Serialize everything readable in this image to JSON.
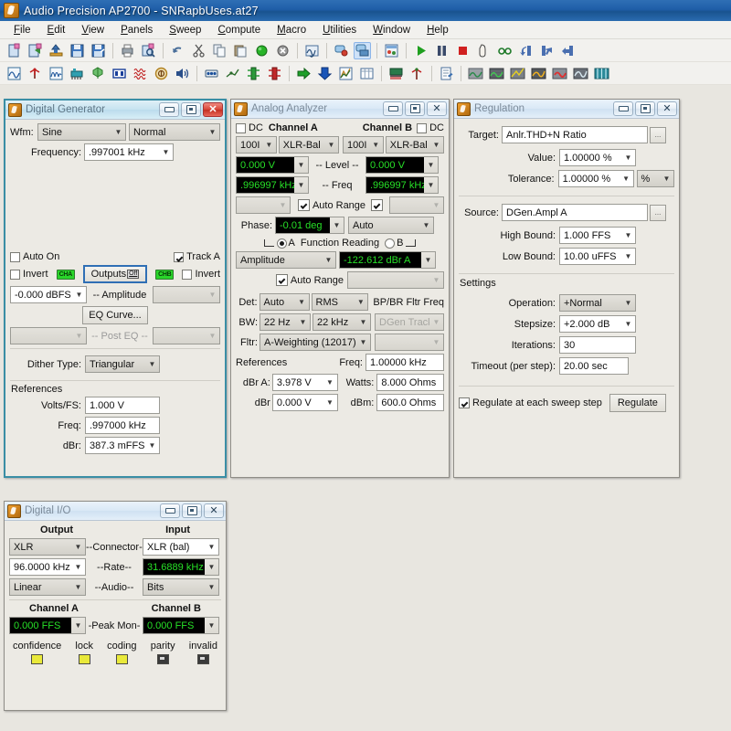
{
  "window": {
    "title": "Audio Precision AP2700 - SNRapbUses.at27",
    "app_icon": "ap-logo-icon"
  },
  "menubar": {
    "items": [
      {
        "label": "File",
        "accel": "F"
      },
      {
        "label": "Edit",
        "accel": "E"
      },
      {
        "label": "View",
        "accel": "V"
      },
      {
        "label": "Panels",
        "accel": "P"
      },
      {
        "label": "Sweep",
        "accel": "S"
      },
      {
        "label": "Compute",
        "accel": "C"
      },
      {
        "label": "Macro",
        "accel": "M"
      },
      {
        "label": "Utilities",
        "accel": "U"
      },
      {
        "label": "Window",
        "accel": "W"
      },
      {
        "label": "Help",
        "accel": "H"
      }
    ]
  },
  "toolbar_row1": [
    {
      "name": "new-test-icon"
    },
    {
      "name": "open-test-icon"
    },
    {
      "name": "load-settings-icon"
    },
    {
      "name": "save-icon"
    },
    {
      "name": "save-as-icon"
    },
    {
      "sep": true
    },
    {
      "name": "print-icon"
    },
    {
      "name": "print-preview-icon"
    },
    {
      "sep": true
    },
    {
      "name": "undo-icon"
    },
    {
      "name": "cut-icon"
    },
    {
      "name": "copy-icon"
    },
    {
      "name": "paste-icon"
    },
    {
      "name": "go-green-icon"
    },
    {
      "name": "stop-gray-icon"
    },
    {
      "sep": true
    },
    {
      "name": "waveform-display-icon"
    },
    {
      "sep": true
    },
    {
      "name": "comment-red-icon"
    },
    {
      "name": "comment-blue-icon",
      "selected": true
    },
    {
      "sep": true
    },
    {
      "name": "panel-properties-icon"
    },
    {
      "sep": true
    },
    {
      "name": "run-icon"
    },
    {
      "name": "pause-icon"
    },
    {
      "name": "stop-icon"
    },
    {
      "name": "mouse-pointer-icon"
    },
    {
      "name": "glasses-icon"
    },
    {
      "name": "step-back-icon"
    },
    {
      "name": "step-into-icon"
    },
    {
      "name": "step-out-icon"
    }
  ],
  "toolbar_row2": [
    {
      "name": "analog-analyzer-icon"
    },
    {
      "name": "analog-generator-icon"
    },
    {
      "name": "sweep-panel-icon"
    },
    {
      "name": "digital-io-icon"
    },
    {
      "name": "digital-generator-icon"
    },
    {
      "name": "dsp-audio-icon"
    },
    {
      "name": "bandpass-icon"
    },
    {
      "name": "multitone-icon"
    },
    {
      "name": "speaker-icon"
    },
    {
      "sep": true
    },
    {
      "name": "external-sync-icon"
    },
    {
      "name": "signal-path-icon"
    },
    {
      "name": "switcher-a-icon"
    },
    {
      "name": "switcher-b-icon"
    },
    {
      "sep": true
    },
    {
      "name": "export-icon"
    },
    {
      "name": "import-icon"
    },
    {
      "name": "graph-icon"
    },
    {
      "name": "data-table-icon"
    },
    {
      "sep": true
    },
    {
      "name": "regulation-icon"
    },
    {
      "name": "sweep-start-icon"
    },
    {
      "sep": true
    },
    {
      "name": "report-icon"
    },
    {
      "sep": true
    },
    {
      "name": "bargraph-gray-icon"
    },
    {
      "name": "bargraph-green-icon"
    },
    {
      "name": "bargraph-yellow-icon"
    },
    {
      "name": "bargraph-orange-icon"
    },
    {
      "name": "bargraph-red-icon"
    },
    {
      "name": "bargraph-dark-icon"
    },
    {
      "name": "bargraph-teal-icon"
    }
  ],
  "digital_generator": {
    "title": "Digital Generator",
    "wfm_label": "Wfm:",
    "waveform": "Sine",
    "waveform_mode": "Normal",
    "frequency_label": "Frequency:",
    "frequency": ".997001 kHz",
    "auto_on_label": "Auto On",
    "auto_on_checked": false,
    "invert_a_label": "Invert",
    "invert_a_checked": false,
    "track_a_label": "Track A",
    "track_a_checked": true,
    "invert_b_label": "Invert",
    "invert_b_checked": false,
    "cha_badge": "CHA",
    "chb_badge": "CHB",
    "outputs_label": "Outputs",
    "outputs_state": "Off",
    "amplitude_a": "-0.000   dBFS",
    "amplitude_label": "-- Amplitude",
    "amplitude_b": "",
    "eq_curve_label": "EQ Curve...",
    "post_eq_label": "-- Post EQ --",
    "post_eq_a": "",
    "post_eq_b": "",
    "dither_label": "Dither Type:",
    "dither": "Triangular",
    "references_label": "References",
    "volts_fs_label": "Volts/FS:",
    "volts_fs": "1.000    V",
    "freq_label": "Freq:",
    "freq": ".997000 kHz",
    "dbr_label": "dBr:",
    "dbr": "387.3   mFFS"
  },
  "analog_analyzer": {
    "title": "Analog Analyzer",
    "dc_a_label": "DC",
    "dc_a_checked": false,
    "channel_a_label": "Channel A",
    "channel_b_label": "Channel B",
    "dc_b_label": "DC",
    "dc_b_checked": false,
    "range_a": "100I",
    "input_a": "XLR-Bal",
    "range_b": "100I",
    "input_b": "XLR-Bal",
    "level_a": "0.000   V",
    "level_label": "-- Level --",
    "level_b": "0.000   V",
    "freq_a": ".996997 kHz",
    "freq_label": "-- Freq",
    "freq_b": ".996997 kHz",
    "range_sel_a": "",
    "auto_range_label": "Auto Range",
    "auto_range_a_checked": true,
    "auto_range_b_checked": true,
    "range_sel_b": "",
    "phase_label": "Phase:",
    "phase": "-0.01    deg",
    "phase_mode": "Auto",
    "function_reading_label": "Function Reading",
    "fr_a_label": "A",
    "fr_b_label": "B",
    "fr_a_selected": true,
    "function": "Amplitude",
    "function_value": "-122.612 dBr A",
    "fn_auto_range_label": "Auto Range",
    "fn_auto_range_checked": true,
    "fn_range": "",
    "det_label": "Det:",
    "det_mode": "Auto",
    "det_type": "RMS",
    "bpbr_label": "BP/BR Fltr Freq",
    "bw_label": "BW:",
    "bw_low": "22 Hz",
    "bw_high": "22 kHz",
    "bpbr_value": "DGen Track",
    "fltr_label": "Fltr:",
    "filter": "A-Weighting  (12017)",
    "fltr_extra": "",
    "references_label": "References",
    "ref_freq_label": "Freq:",
    "ref_freq": "1.00000 kHz",
    "dbra_label": "dBr A:",
    "dbra": "3.978    V",
    "watts_label": "Watts:",
    "watts": "8.000   Ohms",
    "dbr_label": "dBr",
    "dbr": "0.000    V",
    "dbm_label": "dBm:",
    "dbm": "600.0   Ohms"
  },
  "regulation": {
    "title": "Regulation",
    "target_label": "Target:",
    "target": "Anlr.THD+N Ratio",
    "browse_label": "...",
    "value_label": "Value:",
    "value": "1.00000  %",
    "tolerance_label": "Tolerance:",
    "tolerance": "1.00000  %",
    "tolerance_unit": "%",
    "source_label": "Source:",
    "source": "DGen.Ampl A",
    "high_bound_label": "High Bound:",
    "high_bound": "1.000    FFS",
    "low_bound_label": "Low Bound:",
    "low_bound": "10.00   uFFS",
    "settings_label": "Settings",
    "operation_label": "Operation:",
    "operation": "+Normal",
    "stepsize_label": "Stepsize:",
    "stepsize": "+2.000   dB",
    "iterations_label": "Iterations:",
    "iterations": "30",
    "timeout_label": "Timeout (per step):",
    "timeout": "20.00    sec",
    "regulate_each_label": "Regulate at each sweep step",
    "regulate_each_checked": true,
    "regulate_button": "Regulate"
  },
  "digital_io": {
    "title": "Digital I/O",
    "output_label": "Output",
    "input_label": "Input",
    "connector_label": "--Connector--",
    "output_connector": "XLR",
    "input_connector": "XLR (bal)",
    "rate_label": "--Rate--",
    "output_rate": "96.0000 kHz",
    "input_rate": "31.6889 kHz",
    "audio_label": "--Audio--",
    "output_audio": "Linear",
    "input_audio": "Bits",
    "channel_a_label": "Channel A",
    "channel_b_label": "Channel B",
    "peak_mon_label": "-Peak Mon-",
    "peak_a": "0.000    FFS",
    "peak_b": "0.000    FFS",
    "status": [
      {
        "label": "confidence",
        "state": "on"
      },
      {
        "label": "lock",
        "state": "on"
      },
      {
        "label": "coding",
        "state": "on"
      },
      {
        "label": "parity",
        "state": "off"
      },
      {
        "label": "invalid",
        "state": "off"
      }
    ]
  },
  "colors": {
    "titlebar_blue": "#1f5ea8",
    "led_green": "#27e027",
    "led_bg": "#000000",
    "panel_bg": "#eceae4",
    "desktop_bg": "#e8e6e0",
    "focus_border": "#3a8ea5"
  }
}
